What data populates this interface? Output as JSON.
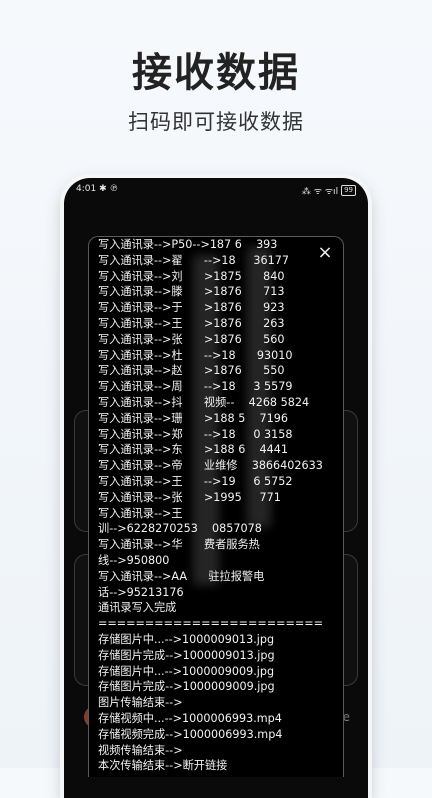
{
  "hero": {
    "title": "接收数据",
    "subtitle": "扫码即可接收数据"
  },
  "status_bar": {
    "time": "4:01",
    "left_icons": "✱ ℗",
    "right_icons": "⁂ ᯤ ᯤıl",
    "battery": "99"
  },
  "background": {
    "avatar_icon": "avatar-icon",
    "trailing_letter": "e"
  },
  "dialog": {
    "close_label": "×",
    "log_lines": [
      "写入通讯录-->P50-->187 6    393",
      "写入通讯录-->翟      -->18     36177",
      "写入通讯录-->刘      >1875      840",
      "写入通讯录-->滕      >1876      713",
      "写入通讯录-->于      >1876      923",
      "写入通讯录-->王      >1876      263",
      "写入通讯录-->张      >1876      560",
      "写入通讯录-->杜      -->18      93010",
      "写入通讯录-->赵      >1876      550",
      "写入通讯录-->周      -->18     3 5579",
      "写入通讯录-->抖      视频--    4268 5824",
      "写入通讯录-->珊      >188 5    7196",
      "写入通讯录-->郑      -->18     0 3158",
      "写入通讯录-->东      >188 6    4441",
      "写入通讯录-->帝      业维修    3866402633",
      "写入通讯录-->王      -->19     6 5752",
      "写入通讯录-->张      >1995     771",
      "写入通讯录-->王",
      "训-->6228270253    0857078",
      "写入通讯录-->华      费者服务热",
      "线-->950800",
      "写入通讯录-->AA      驻拉报警电",
      "话-->95213176",
      "通讯录写入完成",
      "========================",
      "存储图片中...-->1000009013.jpg",
      "存储图片完成-->1000009013.jpg",
      "存储图片中...-->1000009009.jpg",
      "存储图片完成-->1000009009.jpg",
      "图片传输结束-->",
      "存储视频中...-->1000006993.mp4",
      "存储视频完成-->1000006993.mp4",
      "视频传输结束-->",
      "本次传输结束-->断开链接"
    ]
  }
}
